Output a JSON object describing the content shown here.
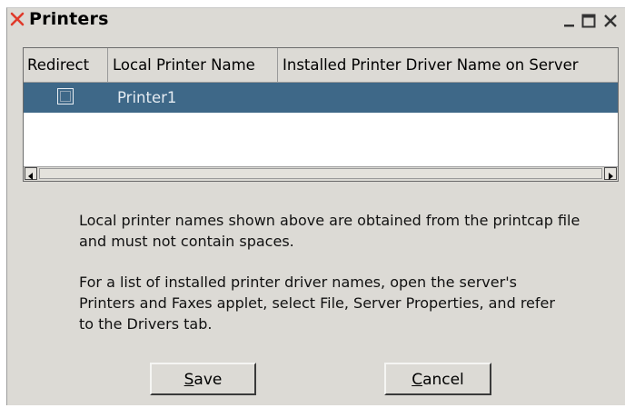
{
  "window": {
    "title": "Printers"
  },
  "table": {
    "columns": [
      "Redirect",
      "Local Printer Name",
      "Installed Printer Driver Name on Server"
    ],
    "rows": [
      {
        "redirect": false,
        "local_printer_name": "Printer1",
        "driver_name": ""
      }
    ]
  },
  "info": {
    "paragraph1": "Local printer names shown above are obtained from the printcap file and must not contain spaces.",
    "paragraph2": "For a list of installed printer driver names, open the server's Printers and Faxes applet, select File, Server Properties, and refer to the Drivers tab."
  },
  "buttons": {
    "save_mnemonic": "S",
    "save_rest": "ave",
    "cancel_mnemonic": "C",
    "cancel_rest": "ancel"
  },
  "colors": {
    "selected_row": "#3e6888",
    "dialog_bg": "#dcdad5",
    "app_icon": "#e03a2a"
  },
  "icons": [
    "x-app-icon",
    "minimize-icon",
    "maximize-icon",
    "close-icon",
    "scroll-left-arrow-icon",
    "scroll-right-arrow-icon"
  ]
}
